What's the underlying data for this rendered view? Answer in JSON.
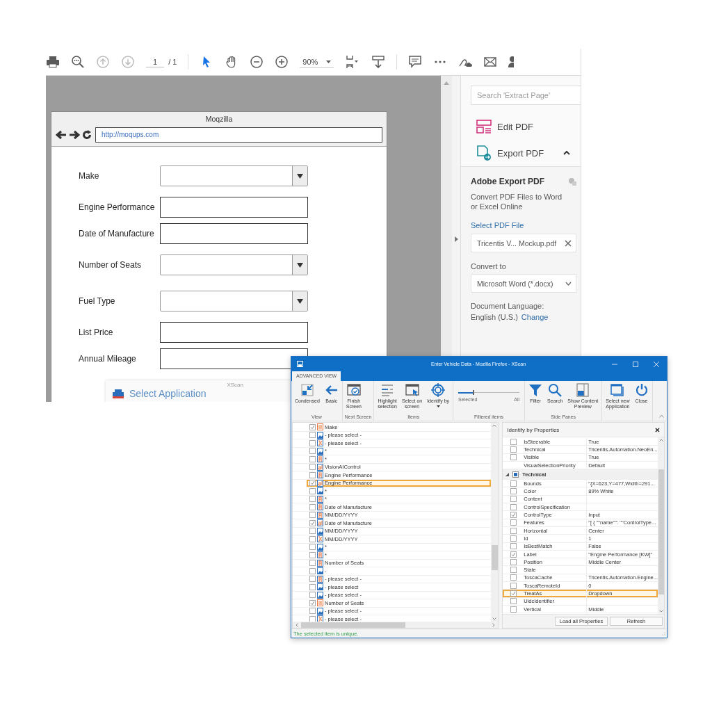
{
  "pdf_viewer": {
    "toolbar": {
      "page_number": "1",
      "page_total": "/ 1",
      "zoom": "90%",
      "tools": [
        {
          "kind": "select",
          "selected": true
        },
        {
          "kind": "hand",
          "selected": false
        }
      ]
    },
    "mockup": {
      "title": "Moqzilla",
      "url": "http://moqups.com",
      "fields": [
        {
          "label": "Make",
          "kind": "dropdown"
        },
        {
          "label": "Engine Performance",
          "kind": "text"
        },
        {
          "label": "Date of Manufacture",
          "kind": "text"
        },
        {
          "label": "Number of Seats",
          "kind": "dropdown"
        },
        {
          "label": "Fuel Type",
          "kind": "dropdown"
        },
        {
          "label": "List Price",
          "kind": "text"
        },
        {
          "label": "Annual Mileage",
          "kind": "text"
        }
      ]
    },
    "select_dialog": {
      "app": "XScan",
      "title": "Select Application"
    },
    "side_pane": {
      "search_placeholder": "Search 'Extract Page'",
      "tools": [
        {
          "kind": "edit",
          "label": "Edit PDF"
        },
        {
          "kind": "export",
          "label": "Export PDF"
        }
      ],
      "export": {
        "expanded": true,
        "title": "Adobe Export PDF",
        "description": "Convert PDF Files to Word or Excel Online",
        "select_link": "Select PDF File",
        "file": "Tricentis V... Mockup.pdf",
        "convert_label": "Convert to",
        "format": "Microsoft Word (*.docx)",
        "language_label": "Document Language:",
        "language": "English (U.S.)",
        "change_link": "Change"
      }
    }
  },
  "xscan": {
    "title": "Enter Vehicle Data - Mozilla Firefox - XScan",
    "tab": "ADVANCED VIEW",
    "ribbon_groups": [
      {
        "label": "View",
        "kind": "buttons",
        "buttons": [
          {
            "label": "Condensed",
            "kind": "condensed",
            "dropdown": false
          },
          {
            "label": "Basic",
            "kind": "back",
            "dropdown": false
          }
        ]
      },
      {
        "label": "Next Screen",
        "kind": "buttons",
        "buttons": [
          {
            "label": "Finish\nScreen",
            "kind": "finish",
            "dropdown": false
          }
        ]
      },
      {
        "label": "Items",
        "kind": "buttons",
        "buttons": [
          {
            "label": "Highlight\nselection",
            "kind": "highlight",
            "dropdown": false
          },
          {
            "label": "Select on\nscreen",
            "kind": "select",
            "dropdown": false
          },
          {
            "label": "Identify by",
            "kind": "target",
            "dropdown": true
          }
        ]
      },
      {
        "label": "Filtered items",
        "kind": "slider",
        "level": 0.25,
        "min_label": "Selected",
        "max_label": "All"
      },
      {
        "label": "Side Panes",
        "kind": "buttons",
        "buttons": [
          {
            "label": "Filter",
            "kind": "filter",
            "dropdown": false
          },
          {
            "label": "Search",
            "kind": "search",
            "dropdown": false
          },
          {
            "label": "Show Content\nPreview",
            "kind": "preview",
            "dropdown": false
          }
        ]
      },
      {
        "kind": "buttons",
        "buttons": [
          {
            "label": "Select new\nApplication",
            "kind": "window",
            "dropdown": false
          },
          {
            "label": "Close",
            "kind": "power",
            "dropdown": false
          }
        ]
      }
    ],
    "tree": [
      {
        "label": "Make",
        "kind": "combobox",
        "checked": true,
        "selected": false
      },
      {
        "label": "- please select -",
        "kind": "image",
        "checked": false,
        "selected": false
      },
      {
        "label": "- please select -",
        "kind": "button",
        "checked": false,
        "selected": false
      },
      {
        "label": "*",
        "kind": "image",
        "checked": false,
        "selected": false
      },
      {
        "label": "*",
        "kind": "text",
        "checked": false,
        "selected": false
      },
      {
        "label": "VisionAIControl",
        "kind": "textbox",
        "checked": false,
        "selected": false
      },
      {
        "label": "Engine Performance",
        "kind": "text",
        "checked": false,
        "selected": false
      },
      {
        "label": "Engine Performance",
        "kind": "textbox",
        "checked": true,
        "selected": true
      },
      {
        "label": "*",
        "kind": "image",
        "checked": false,
        "selected": false
      },
      {
        "label": "*",
        "kind": "text",
        "checked": false,
        "selected": false
      },
      {
        "label": "Date of Manufacture",
        "kind": "text",
        "checked": false,
        "selected": false
      },
      {
        "label": "MM/DD/YYYY",
        "kind": "text",
        "checked": false,
        "selected": false
      },
      {
        "label": "Date of Manufacture",
        "kind": "textbox",
        "checked": true,
        "selected": false
      },
      {
        "label": "MM/DD/YYYY",
        "kind": "image",
        "checked": false,
        "selected": false
      },
      {
        "label": "MM/DD/YYYY",
        "kind": "button",
        "checked": false,
        "selected": false
      },
      {
        "label": "*",
        "kind": "image",
        "checked": false,
        "selected": false
      },
      {
        "label": "*",
        "kind": "text",
        "checked": false,
        "selected": false
      },
      {
        "label": "Number of Seats",
        "kind": "text",
        "checked": false,
        "selected": false
      },
      {
        "label": "-",
        "kind": "image",
        "checked": false,
        "selected": false
      },
      {
        "label": "- please select -",
        "kind": "text",
        "checked": false,
        "selected": false
      },
      {
        "label": "- please select",
        "kind": "image",
        "checked": false,
        "selected": false
      },
      {
        "label": "- please select -",
        "kind": "image",
        "checked": false,
        "selected": false
      },
      {
        "label": "Number of Seats",
        "kind": "combobox",
        "checked": true,
        "selected": false
      },
      {
        "label": "- please select -",
        "kind": "image",
        "checked": false,
        "selected": false
      },
      {
        "label": "- please select -",
        "kind": "button",
        "checked": false,
        "selected": false
      }
    ],
    "properties": {
      "title": "Identify by Properties",
      "rows": [
        {
          "kind": "check",
          "name": "IsSteerable",
          "value": "True",
          "checked": false,
          "selected": false
        },
        {
          "kind": "check",
          "name": "Technical",
          "value": "Tricentis.Automation.NeoEn...",
          "checked": false,
          "selected": false
        },
        {
          "kind": "check",
          "name": "Visible",
          "value": "True",
          "checked": false,
          "selected": false
        },
        {
          "kind": "plain",
          "name": "VisualSelectionPriority",
          "value": "Default",
          "selected": false
        },
        {
          "kind": "group",
          "name": "Technical",
          "expanded": true,
          "partial": true
        },
        {
          "kind": "check",
          "name": "Bounds",
          "value": "\"{X=623,Y=477,Width=291...",
          "checked": false,
          "selected": false
        },
        {
          "kind": "check",
          "name": "Color",
          "value": "89% White",
          "checked": false,
          "selected": false
        },
        {
          "kind": "check",
          "name": "Content",
          "checked": false,
          "selected": false
        },
        {
          "kind": "check",
          "name": "ControlSpecification",
          "checked": false,
          "selected": false
        },
        {
          "kind": "check",
          "name": "ControlType",
          "value": "Input",
          "checked": true,
          "selected": false
        },
        {
          "kind": "check",
          "name": "Features",
          "value": "\"[ { \"\"name\"\": \"\"ControlType...",
          "checked": false,
          "selected": false
        },
        {
          "kind": "check",
          "name": "Horizontal",
          "value": "Center",
          "checked": false,
          "selected": false
        },
        {
          "kind": "check",
          "name": "Id",
          "value": "1",
          "checked": false,
          "selected": false
        },
        {
          "kind": "check",
          "name": "IsBestMatch",
          "value": "False",
          "checked": false,
          "selected": false
        },
        {
          "kind": "check",
          "name": "Label",
          "value": "\"Engine Performance [KW]\"",
          "checked": true,
          "selected": false
        },
        {
          "kind": "check",
          "name": "Position",
          "value": "Middle Center",
          "checked": false,
          "selected": false
        },
        {
          "kind": "check",
          "name": "State",
          "checked": false,
          "selected": false
        },
        {
          "kind": "check",
          "name": "ToscaCache",
          "value": "Tricentis.Automation.Engine...",
          "checked": false,
          "selected": false
        },
        {
          "kind": "check",
          "name": "ToscaRemoteId",
          "value": "0",
          "checked": false,
          "selected": false
        },
        {
          "kind": "check",
          "name": "TreatAs",
          "value": "Dropdown",
          "checked": true,
          "selected": true
        },
        {
          "kind": "check",
          "name": "UidcIdentifier",
          "checked": false,
          "selected": false
        },
        {
          "kind": "check",
          "name": "Vertical",
          "value": "Middle",
          "checked": false,
          "selected": false
        }
      ],
      "buttons": [
        "Load all Properties",
        "Refresh"
      ]
    },
    "status": "The selected item is unique."
  }
}
